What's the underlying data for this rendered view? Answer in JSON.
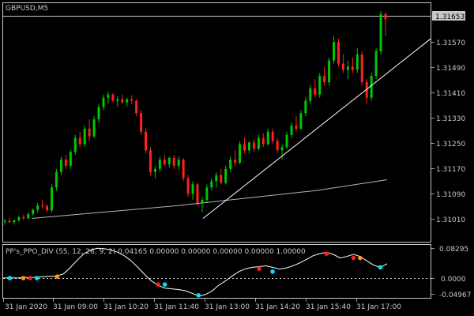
{
  "window": {
    "symbol_title": "GBPUSD,M5",
    "current_price": "1.31653"
  },
  "price_axis": {
    "labels": [
      "1.31570",
      "1.31490",
      "1.31410",
      "1.31330",
      "1.31250",
      "1.31170",
      "1.31090",
      "1.31010"
    ]
  },
  "indicator": {
    "title": "PP's_PPO_DIV (55, 12, 26, 9, 2) 0.04165 0.00000 0.00000 0.00000 0.00000 1.00000",
    "axis_labels": [
      "0.08295",
      "0.0000",
      "-0.04967"
    ]
  },
  "time_axis": {
    "labels": [
      "31 Jan 2020",
      "31 Jan 09:00",
      "31 Jan 10:20",
      "31 Jan 11:40",
      "31 Jan 13:00",
      "31 Jan 14:20",
      "31 Jan 15:40",
      "31 Jan 17:00"
    ]
  },
  "colors": {
    "background": "#000000",
    "bull_candle": "#00c800",
    "bear_candle": "#ff2020",
    "grid_frame": "#c8c8c8",
    "trend_line": "#ffffff",
    "moving_average": "#b4b4b4",
    "ppo_line": "#ffffff",
    "marker_cyan": "#00e5ff",
    "marker_red": "#ff1e1e",
    "marker_orange": "#ff9a00"
  },
  "chart_data": [
    {
      "type": "candlestick",
      "title": "GBPUSD,M5",
      "ylim": [
        1.3095,
        1.3169
      ],
      "last_price": 1.31653,
      "series": [
        {
          "name": "GBPUSD,M5",
          "ohlc": [
            [
              1.31,
              1.31008,
              1.3099,
              1.31002
            ],
            [
              1.31002,
              1.31012,
              1.30995,
              1.30998
            ],
            [
              1.30998,
              1.31006,
              1.3099,
              1.31004
            ],
            [
              1.31004,
              1.31018,
              1.31,
              1.31014
            ],
            [
              1.31014,
              1.31022,
              1.31005,
              1.3101
            ],
            [
              1.3101,
              1.31028,
              1.31008,
              1.31024
            ],
            [
              1.31024,
              1.31042,
              1.31018,
              1.31038
            ],
            [
              1.31038,
              1.3106,
              1.3103,
              1.31052
            ],
            [
              1.31052,
              1.3107,
              1.3104,
              1.3105
            ],
            [
              1.3105,
              1.31055,
              1.3103,
              1.31036
            ],
            [
              1.31036,
              1.3112,
              1.3103,
              1.3111
            ],
            [
              1.3111,
              1.3117,
              1.311,
              1.3116
            ],
            [
              1.3116,
              1.3121,
              1.3115,
              1.312
            ],
            [
              1.312,
              1.31215,
              1.3117,
              1.3118
            ],
            [
              1.3118,
              1.3123,
              1.3117,
              1.31225
            ],
            [
              1.31225,
              1.3128,
              1.31215,
              1.3127
            ],
            [
              1.3127,
              1.3129,
              1.3124,
              1.3125
            ],
            [
              1.3125,
              1.3131,
              1.3124,
              1.313
            ],
            [
              1.313,
              1.3133,
              1.3126,
              1.31275
            ],
            [
              1.31275,
              1.3134,
              1.3127,
              1.3133
            ],
            [
              1.3133,
              1.3138,
              1.3132,
              1.3137
            ],
            [
              1.3137,
              1.3141,
              1.3136,
              1.314
            ],
            [
              1.314,
              1.3142,
              1.3138,
              1.3141
            ],
            [
              1.3141,
              1.31415,
              1.31385,
              1.3139
            ],
            [
              1.3139,
              1.31405,
              1.3137,
              1.31395
            ],
            [
              1.31395,
              1.3141,
              1.3138,
              1.31385
            ],
            [
              1.31385,
              1.314,
              1.3137,
              1.31395
            ],
            [
              1.31395,
              1.31408,
              1.3138,
              1.3139
            ],
            [
              1.3139,
              1.31395,
              1.3134,
              1.3135
            ],
            [
              1.3135,
              1.3136,
              1.3128,
              1.3129
            ],
            [
              1.3129,
              1.313,
              1.3122,
              1.3123
            ],
            [
              1.3123,
              1.3124,
              1.3115,
              1.3116
            ],
            [
              1.3116,
              1.3118,
              1.3114,
              1.3117
            ],
            [
              1.3117,
              1.3121,
              1.3116,
              1.312
            ],
            [
              1.312,
              1.31215,
              1.3118,
              1.31185
            ],
            [
              1.31185,
              1.3121,
              1.31175,
              1.31205
            ],
            [
              1.31205,
              1.31215,
              1.3117,
              1.3118
            ],
            [
              1.3118,
              1.3121,
              1.3117,
              1.312
            ],
            [
              1.312,
              1.31205,
              1.3113,
              1.3114
            ],
            [
              1.3114,
              1.3115,
              1.3108,
              1.3109
            ],
            [
              1.3109,
              1.3113,
              1.3107,
              1.3112
            ],
            [
              1.3112,
              1.31125,
              1.3105,
              1.3106
            ],
            [
              1.3106,
              1.3108,
              1.3103,
              1.3107
            ],
            [
              1.3107,
              1.3112,
              1.3106,
              1.3111
            ],
            [
              1.3111,
              1.3114,
              1.311,
              1.3113
            ],
            [
              1.3113,
              1.3116,
              1.3111,
              1.3115
            ],
            [
              1.3115,
              1.3117,
              1.3112,
              1.31125
            ],
            [
              1.31125,
              1.3118,
              1.3112,
              1.3117
            ],
            [
              1.3117,
              1.3121,
              1.3116,
              1.312
            ],
            [
              1.312,
              1.3123,
              1.3118,
              1.3119
            ],
            [
              1.3119,
              1.3126,
              1.31185,
              1.3125
            ],
            [
              1.3125,
              1.3127,
              1.3122,
              1.3123
            ],
            [
              1.3123,
              1.3126,
              1.3122,
              1.31255
            ],
            [
              1.31255,
              1.31265,
              1.31225,
              1.31235
            ],
            [
              1.31235,
              1.3128,
              1.3123,
              1.3127
            ],
            [
              1.3127,
              1.31285,
              1.3124,
              1.3125
            ],
            [
              1.3125,
              1.313,
              1.31245,
              1.3129
            ],
            [
              1.3129,
              1.313,
              1.3125,
              1.3126
            ],
            [
              1.3126,
              1.3127,
              1.3122,
              1.3123
            ],
            [
              1.3123,
              1.3125,
              1.312,
              1.3124
            ],
            [
              1.3124,
              1.3129,
              1.31235,
              1.3128
            ],
            [
              1.3128,
              1.3132,
              1.3127,
              1.3131
            ],
            [
              1.3131,
              1.3134,
              1.3129,
              1.313
            ],
            [
              1.313,
              1.3136,
              1.31295,
              1.3135
            ],
            [
              1.3135,
              1.314,
              1.3134,
              1.3139
            ],
            [
              1.3139,
              1.3144,
              1.3138,
              1.3143
            ],
            [
              1.3143,
              1.3146,
              1.314,
              1.3141
            ],
            [
              1.3141,
              1.3148,
              1.314,
              1.3147
            ],
            [
              1.3147,
              1.315,
              1.3144,
              1.3145
            ],
            [
              1.3145,
              1.3153,
              1.3144,
              1.3152
            ],
            [
              1.3152,
              1.316,
              1.3151,
              1.3158
            ],
            [
              1.3158,
              1.3159,
              1.315,
              1.3151
            ],
            [
              1.3151,
              1.3154,
              1.3148,
              1.3149
            ],
            [
              1.3149,
              1.3152,
              1.3146,
              1.315
            ],
            [
              1.315,
              1.3153,
              1.3148,
              1.3149
            ],
            [
              1.3149,
              1.3156,
              1.3148,
              1.3154
            ],
            [
              1.3154,
              1.3155,
              1.3144,
              1.3145
            ],
            [
              1.3145,
              1.3146,
              1.3138,
              1.314
            ],
            [
              1.314,
              1.3148,
              1.3139,
              1.3147
            ],
            [
              1.3147,
              1.3156,
              1.3146,
              1.3155
            ],
            [
              1.3155,
              1.3168,
              1.3154,
              1.3167
            ],
            [
              1.3167,
              1.31675,
              1.316,
              1.31653
            ]
          ]
        },
        {
          "name": "moving average",
          "values": [
            1.3101,
            1.3103,
            1.3105,
            1.31075,
            1.311,
            1.31135
          ]
        },
        {
          "name": "trend line",
          "values": [
            1.3101,
            1.3159
          ]
        }
      ]
    },
    {
      "type": "line",
      "title": "PP's_PPO_DIV (55, 12, 26, 9, 2) 0.04165 0.00000 0.00000 0.00000 0.00000 1.00000",
      "ylim": [
        -0.055,
        0.088
      ],
      "series": [
        {
          "name": "PPO",
          "values": [
            0.0,
            0.001,
            0.0,
            0.002,
            0.001,
            0.003,
            0.004,
            0.005,
            0.006,
            0.012,
            0.03,
            0.05,
            0.068,
            0.078,
            0.083,
            0.082,
            0.078,
            0.072,
            0.062,
            0.048,
            0.03,
            0.01,
            -0.008,
            -0.02,
            -0.028,
            -0.03,
            -0.032,
            -0.035,
            -0.042,
            -0.05,
            -0.046,
            -0.036,
            -0.02,
            -0.008,
            0.006,
            0.018,
            0.026,
            0.03,
            0.032,
            0.034,
            0.03,
            0.025,
            0.028,
            0.034,
            0.042,
            0.052,
            0.062,
            0.068,
            0.072,
            0.066,
            0.056,
            0.06,
            0.066,
            0.06,
            0.048,
            0.036,
            0.03,
            0.04
          ]
        }
      ],
      "markers": [
        {
          "index": 1,
          "value": 0.0,
          "color": "cyan"
        },
        {
          "index": 3,
          "value": 0.0,
          "color": "orange"
        },
        {
          "index": 4,
          "value": 0.0,
          "color": "red"
        },
        {
          "index": 5,
          "value": 0.0,
          "color": "cyan"
        },
        {
          "index": 8,
          "value": 0.004,
          "color": "orange"
        },
        {
          "index": 23,
          "value": -0.018,
          "color": "red"
        },
        {
          "index": 24,
          "value": -0.018,
          "color": "cyan"
        },
        {
          "index": 29,
          "value": -0.048,
          "color": "cyan"
        },
        {
          "index": 38,
          "value": 0.026,
          "color": "red"
        },
        {
          "index": 40,
          "value": 0.018,
          "color": "cyan"
        },
        {
          "index": 48,
          "value": 0.068,
          "color": "red"
        },
        {
          "index": 52,
          "value": 0.056,
          "color": "red"
        },
        {
          "index": 53,
          "value": 0.056,
          "color": "orange"
        },
        {
          "index": 56,
          "value": 0.03,
          "color": "cyan"
        }
      ]
    }
  ]
}
